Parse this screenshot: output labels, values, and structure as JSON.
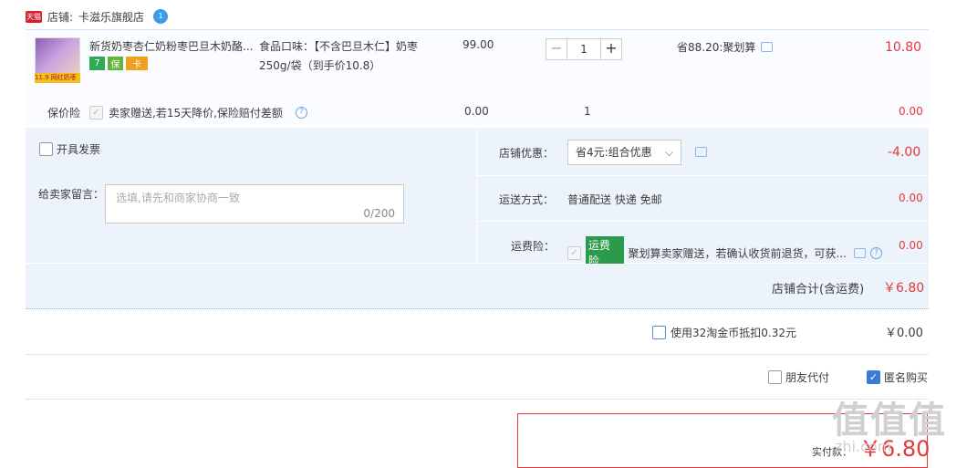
{
  "store": {
    "badge": "天猫",
    "label": "店铺:",
    "name": "卡滋乐旗舰店",
    "wang_icon": "1"
  },
  "item": {
    "thumb_tag": "11.9 网红奶枣",
    "title": "新货奶枣杏仁奶粉枣巴旦木奶酪...",
    "sku_line1": "食品口味：【不含巴旦木仁】奶枣",
    "sku_line2": "250g/袋（到手价10.8）",
    "unit_price": "99.00",
    "qty_minus": "−",
    "qty": "1",
    "qty_plus": "+",
    "discount": "省88.20:聚划算",
    "subtotal": "10.80",
    "icons": [
      "7",
      "保",
      "卡"
    ]
  },
  "insurance": {
    "label": "保价险",
    "check": "✓",
    "desc": "卖家赠送,若15天降价,保险赔付差额",
    "help": "?",
    "price": "0.00",
    "qty": "1",
    "total": "0.00"
  },
  "invoice": {
    "label": "开具发票"
  },
  "message": {
    "label": "给卖家留言：",
    "placeholder": "选填,请先和商家协商一致",
    "counter": "0/200"
  },
  "promo": {
    "label": "店铺优惠：",
    "selected": "省4元:组合优惠",
    "amount": "-4.00"
  },
  "shipping": {
    "label": "运送方式：",
    "value": "普通配送 快递 免邮",
    "amount": "0.00"
  },
  "freight_ins": {
    "label": "运费险：",
    "check": "✓",
    "tag": "运费险",
    "desc": "聚划算卖家赠送，若确认收货前退货，可获...",
    "help": "?",
    "amount": "0.00"
  },
  "store_total": {
    "label": "店铺合计(含运费)",
    "value": "￥6.80"
  },
  "coins": {
    "label": "使用32淘金币抵扣0.32元",
    "value": "￥0.00"
  },
  "friend_pay": {
    "label": "朋友代付"
  },
  "anonymous": {
    "label": "匿名购买",
    "check": "✓"
  },
  "payment": {
    "label": "实付款：",
    "value": "￥6.80"
  },
  "watermark": {
    "text": "值值值",
    "url": "zhi.com"
  }
}
